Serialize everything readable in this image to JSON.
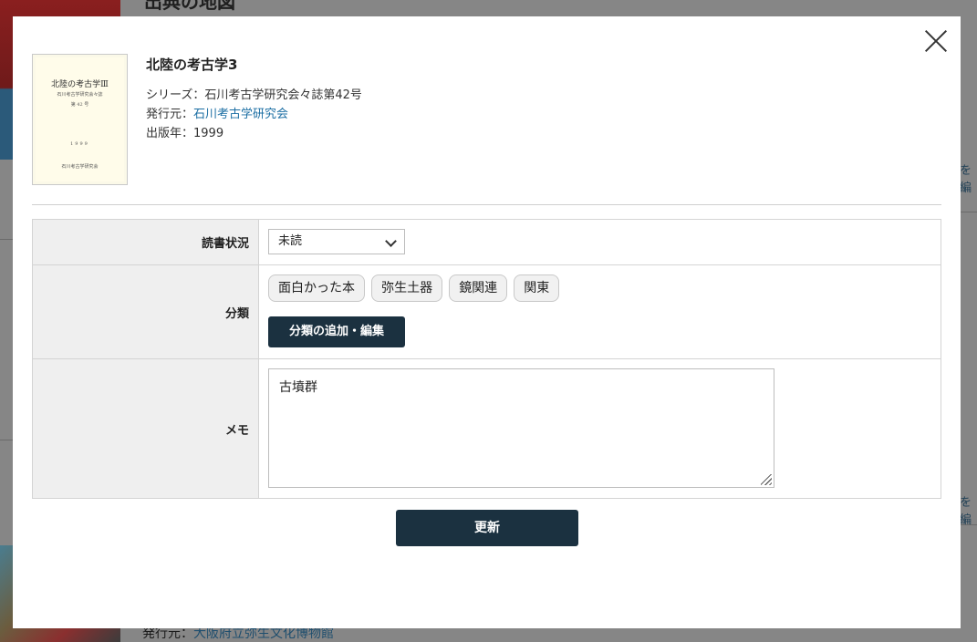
{
  "background": {
    "header_text": "出典の地図",
    "edge_text": "を編",
    "publisher_label": "発行元：",
    "publisher_name": "大阪府立弥生文化博物館"
  },
  "modal": {
    "book": {
      "title": "北陸の考古学3",
      "series_label": "シリーズ：",
      "series_value": "石川考古学研究会々誌第42号",
      "publisher_label": "発行元：",
      "publisher_value": "石川考古学研究会",
      "year_label": "出版年：",
      "year_value": "1999",
      "cover": {
        "title": "北陸の考古学Ⅲ",
        "subtitle": "石川考古学研究会々誌",
        "number": "第 42 号",
        "year": "1999",
        "publisher": "石川考古学研究会"
      }
    },
    "form": {
      "status_label": "読書状況",
      "status_value": "未読",
      "category_label": "分類",
      "tags": [
        "面白かった本",
        "弥生土器",
        "鏡関連",
        "関東"
      ],
      "add_category_label": "分類の追加・編集",
      "memo_label": "メモ",
      "memo_value": "古墳群"
    },
    "update_label": "更新"
  },
  "colors": {
    "dark_button": "#1b3140",
    "link": "#1b6ea3",
    "header_cell": "#efefef"
  }
}
